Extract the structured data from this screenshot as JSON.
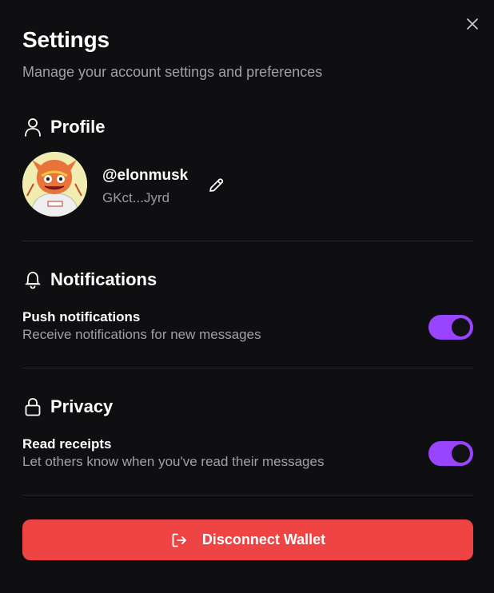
{
  "header": {
    "title": "Settings",
    "subtitle": "Manage your account settings and preferences",
    "close_icon": "close-icon"
  },
  "profile": {
    "section_label": "Profile",
    "section_icon": "user-icon",
    "username": "@elonmusk",
    "address": "GKct...Jyrd",
    "avatar": "avatar-image",
    "edit_icon": "pencil-icon"
  },
  "notifications": {
    "section_label": "Notifications",
    "section_icon": "bell-icon",
    "push": {
      "title": "Push notifications",
      "description": "Receive notifications for new messages",
      "enabled": true
    }
  },
  "privacy": {
    "section_label": "Privacy",
    "section_icon": "lock-icon",
    "read_receipts": {
      "title": "Read receipts",
      "description": "Let others know when you've read their messages",
      "enabled": true
    }
  },
  "actions": {
    "disconnect_label": "Disconnect Wallet",
    "disconnect_icon": "logout-icon"
  },
  "colors": {
    "background": "#0f0f12",
    "accent": "#9945ff",
    "danger": "#ef4444",
    "muted_text": "#a0a0a8",
    "divider": "#26262b"
  }
}
